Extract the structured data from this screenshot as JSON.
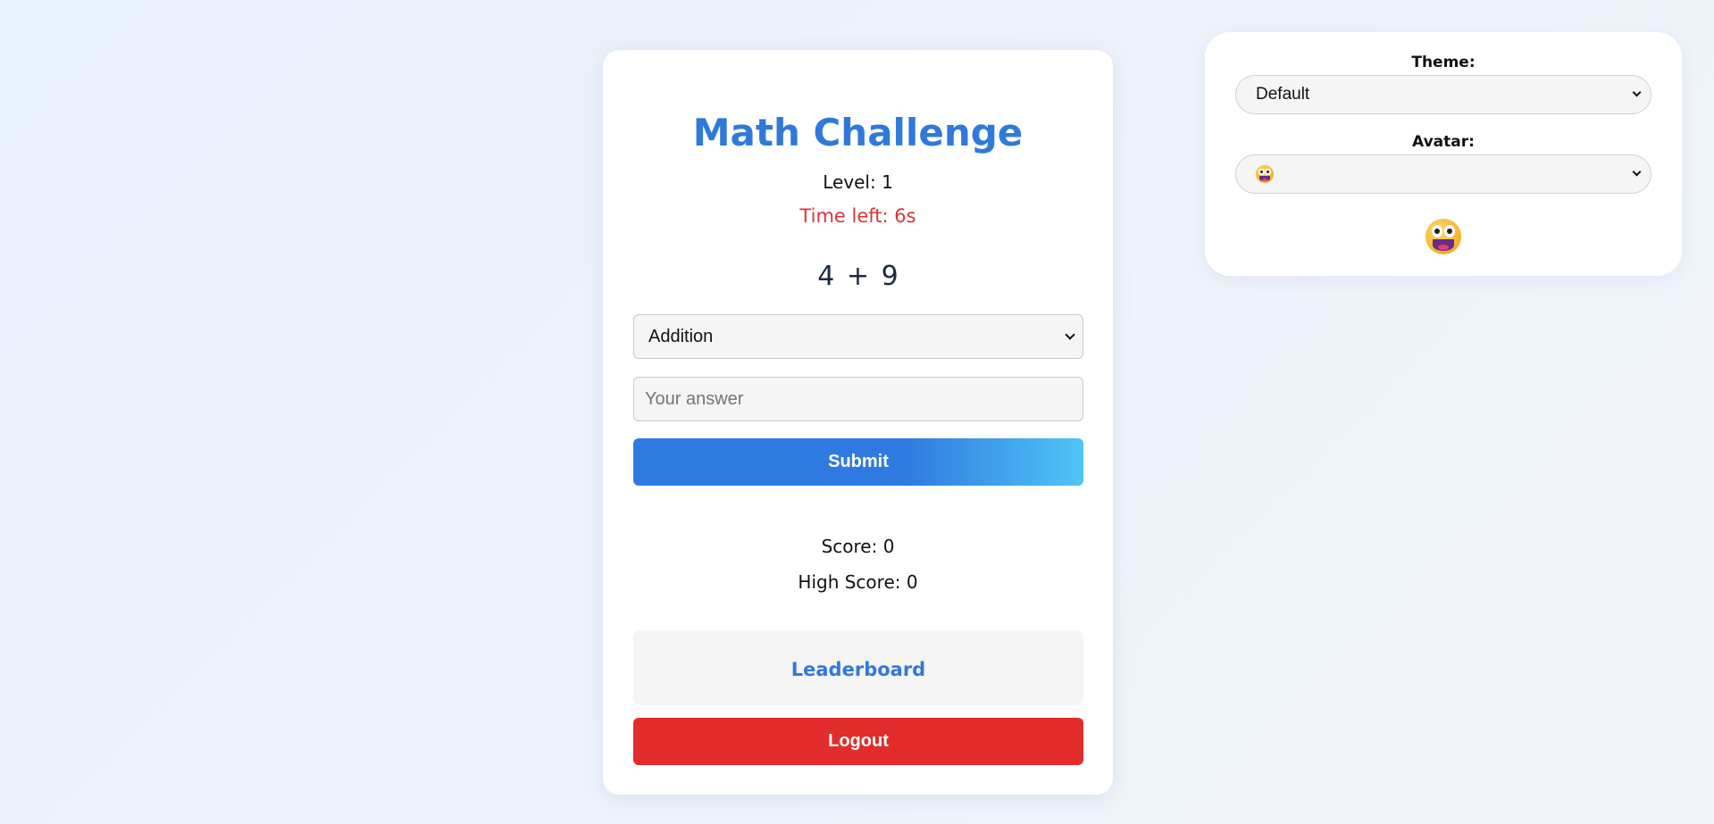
{
  "game": {
    "title": "Math Challenge",
    "level": "Level: 1",
    "time_left": "Time left: 6s",
    "problem": "4 + 9",
    "operation": "Addition",
    "answer_placeholder": "Your answer",
    "answer_value": "",
    "submit_label": "Submit",
    "score": "Score: 0",
    "high_score": "High Score: 0",
    "leaderboard_title": "Leaderboard",
    "logout_label": "Logout"
  },
  "settings": {
    "theme_label": "Theme:",
    "theme_value": "Default",
    "avatar_label": "Avatar:",
    "avatar_value_icon": "grinning-face-emoji-icon",
    "avatar_preview_icon": "grinning-face-emoji-icon"
  },
  "colors": {
    "title_blue": "#2f7ad9",
    "timer_red": "#d93636",
    "submit_gradient_start": "#2f7ae0",
    "submit_gradient_end": "#4fc4f5",
    "logout_red": "#e32c2c",
    "background": "#e8f0fb"
  }
}
